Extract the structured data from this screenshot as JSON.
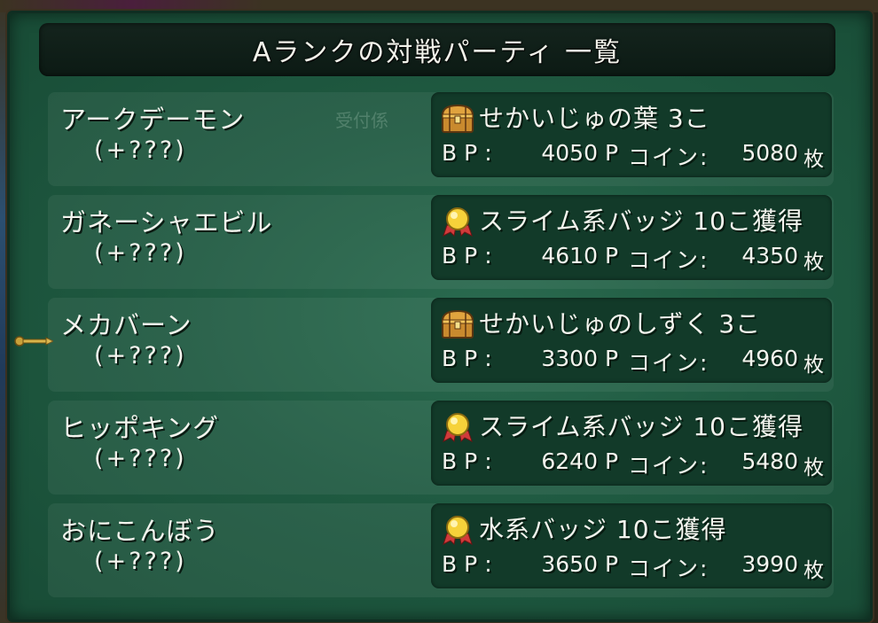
{
  "title": "Aランクの対戦パーティ 一覧",
  "ghost_label": "受付係",
  "columns": {
    "bp_label": "BP:",
    "bp_unit": "P",
    "coin_label": "コイン:",
    "coin_unit": "枚"
  },
  "parties": [
    {
      "name": "アークデーモン",
      "level": "(+???)",
      "reward_icon": "treasure-chest-icon",
      "reward": "せかいじゅの葉 3こ",
      "bp": "4050",
      "coins": "5080"
    },
    {
      "name": "ガネーシャエビル",
      "level": "(+???)",
      "reward_icon": "medal-icon",
      "reward": "スライム系バッジ 10こ獲得",
      "bp": "4610",
      "coins": "4350"
    },
    {
      "name": "メカバーン",
      "level": "(+???)",
      "reward_icon": "treasure-chest-icon",
      "reward": "せかいじゅのしずく 3こ",
      "bp": "3300",
      "coins": "4960"
    },
    {
      "name": "ヒッポキング",
      "level": "(+???)",
      "reward_icon": "medal-icon",
      "reward": "スライム系バッジ 10こ獲得",
      "bp": "6240",
      "coins": "5480"
    },
    {
      "name": "おにこんぼう",
      "level": "(+???)",
      "reward_icon": "medal-icon",
      "reward": "水系バッジ 10こ獲得",
      "bp": "3650",
      "coins": "3990"
    }
  ]
}
